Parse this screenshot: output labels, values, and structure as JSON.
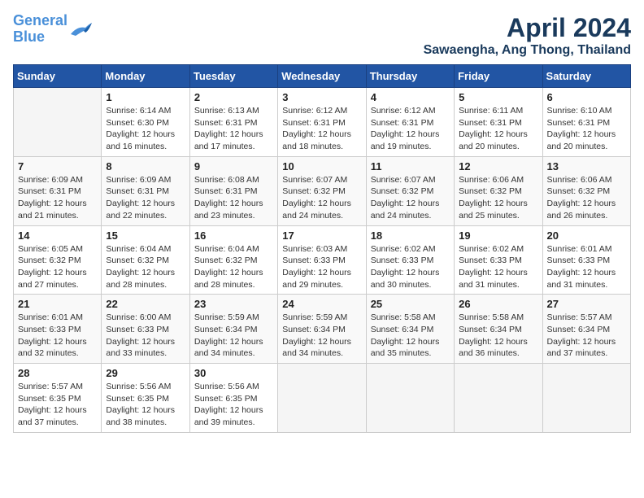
{
  "header": {
    "logo_line1": "General",
    "logo_line2": "Blue",
    "title": "April 2024",
    "subtitle": "Sawaengha, Ang Thong, Thailand"
  },
  "days_of_week": [
    "Sunday",
    "Monday",
    "Tuesday",
    "Wednesday",
    "Thursday",
    "Friday",
    "Saturday"
  ],
  "weeks": [
    [
      {
        "day": "",
        "sunrise": "",
        "sunset": "",
        "daylight": ""
      },
      {
        "day": "1",
        "sunrise": "Sunrise: 6:14 AM",
        "sunset": "Sunset: 6:30 PM",
        "daylight": "Daylight: 12 hours and 16 minutes."
      },
      {
        "day": "2",
        "sunrise": "Sunrise: 6:13 AM",
        "sunset": "Sunset: 6:31 PM",
        "daylight": "Daylight: 12 hours and 17 minutes."
      },
      {
        "day": "3",
        "sunrise": "Sunrise: 6:12 AM",
        "sunset": "Sunset: 6:31 PM",
        "daylight": "Daylight: 12 hours and 18 minutes."
      },
      {
        "day": "4",
        "sunrise": "Sunrise: 6:12 AM",
        "sunset": "Sunset: 6:31 PM",
        "daylight": "Daylight: 12 hours and 19 minutes."
      },
      {
        "day": "5",
        "sunrise": "Sunrise: 6:11 AM",
        "sunset": "Sunset: 6:31 PM",
        "daylight": "Daylight: 12 hours and 20 minutes."
      },
      {
        "day": "6",
        "sunrise": "Sunrise: 6:10 AM",
        "sunset": "Sunset: 6:31 PM",
        "daylight": "Daylight: 12 hours and 20 minutes."
      }
    ],
    [
      {
        "day": "7",
        "sunrise": "Sunrise: 6:09 AM",
        "sunset": "Sunset: 6:31 PM",
        "daylight": "Daylight: 12 hours and 21 minutes."
      },
      {
        "day": "8",
        "sunrise": "Sunrise: 6:09 AM",
        "sunset": "Sunset: 6:31 PM",
        "daylight": "Daylight: 12 hours and 22 minutes."
      },
      {
        "day": "9",
        "sunrise": "Sunrise: 6:08 AM",
        "sunset": "Sunset: 6:31 PM",
        "daylight": "Daylight: 12 hours and 23 minutes."
      },
      {
        "day": "10",
        "sunrise": "Sunrise: 6:07 AM",
        "sunset": "Sunset: 6:32 PM",
        "daylight": "Daylight: 12 hours and 24 minutes."
      },
      {
        "day": "11",
        "sunrise": "Sunrise: 6:07 AM",
        "sunset": "Sunset: 6:32 PM",
        "daylight": "Daylight: 12 hours and 24 minutes."
      },
      {
        "day": "12",
        "sunrise": "Sunrise: 6:06 AM",
        "sunset": "Sunset: 6:32 PM",
        "daylight": "Daylight: 12 hours and 25 minutes."
      },
      {
        "day": "13",
        "sunrise": "Sunrise: 6:06 AM",
        "sunset": "Sunset: 6:32 PM",
        "daylight": "Daylight: 12 hours and 26 minutes."
      }
    ],
    [
      {
        "day": "14",
        "sunrise": "Sunrise: 6:05 AM",
        "sunset": "Sunset: 6:32 PM",
        "daylight": "Daylight: 12 hours and 27 minutes."
      },
      {
        "day": "15",
        "sunrise": "Sunrise: 6:04 AM",
        "sunset": "Sunset: 6:32 PM",
        "daylight": "Daylight: 12 hours and 28 minutes."
      },
      {
        "day": "16",
        "sunrise": "Sunrise: 6:04 AM",
        "sunset": "Sunset: 6:32 PM",
        "daylight": "Daylight: 12 hours and 28 minutes."
      },
      {
        "day": "17",
        "sunrise": "Sunrise: 6:03 AM",
        "sunset": "Sunset: 6:33 PM",
        "daylight": "Daylight: 12 hours and 29 minutes."
      },
      {
        "day": "18",
        "sunrise": "Sunrise: 6:02 AM",
        "sunset": "Sunset: 6:33 PM",
        "daylight": "Daylight: 12 hours and 30 minutes."
      },
      {
        "day": "19",
        "sunrise": "Sunrise: 6:02 AM",
        "sunset": "Sunset: 6:33 PM",
        "daylight": "Daylight: 12 hours and 31 minutes."
      },
      {
        "day": "20",
        "sunrise": "Sunrise: 6:01 AM",
        "sunset": "Sunset: 6:33 PM",
        "daylight": "Daylight: 12 hours and 31 minutes."
      }
    ],
    [
      {
        "day": "21",
        "sunrise": "Sunrise: 6:01 AM",
        "sunset": "Sunset: 6:33 PM",
        "daylight": "Daylight: 12 hours and 32 minutes."
      },
      {
        "day": "22",
        "sunrise": "Sunrise: 6:00 AM",
        "sunset": "Sunset: 6:33 PM",
        "daylight": "Daylight: 12 hours and 33 minutes."
      },
      {
        "day": "23",
        "sunrise": "Sunrise: 5:59 AM",
        "sunset": "Sunset: 6:34 PM",
        "daylight": "Daylight: 12 hours and 34 minutes."
      },
      {
        "day": "24",
        "sunrise": "Sunrise: 5:59 AM",
        "sunset": "Sunset: 6:34 PM",
        "daylight": "Daylight: 12 hours and 34 minutes."
      },
      {
        "day": "25",
        "sunrise": "Sunrise: 5:58 AM",
        "sunset": "Sunset: 6:34 PM",
        "daylight": "Daylight: 12 hours and 35 minutes."
      },
      {
        "day": "26",
        "sunrise": "Sunrise: 5:58 AM",
        "sunset": "Sunset: 6:34 PM",
        "daylight": "Daylight: 12 hours and 36 minutes."
      },
      {
        "day": "27",
        "sunrise": "Sunrise: 5:57 AM",
        "sunset": "Sunset: 6:34 PM",
        "daylight": "Daylight: 12 hours and 37 minutes."
      }
    ],
    [
      {
        "day": "28",
        "sunrise": "Sunrise: 5:57 AM",
        "sunset": "Sunset: 6:35 PM",
        "daylight": "Daylight: 12 hours and 37 minutes."
      },
      {
        "day": "29",
        "sunrise": "Sunrise: 5:56 AM",
        "sunset": "Sunset: 6:35 PM",
        "daylight": "Daylight: 12 hours and 38 minutes."
      },
      {
        "day": "30",
        "sunrise": "Sunrise: 5:56 AM",
        "sunset": "Sunset: 6:35 PM",
        "daylight": "Daylight: 12 hours and 39 minutes."
      },
      {
        "day": "",
        "sunrise": "",
        "sunset": "",
        "daylight": ""
      },
      {
        "day": "",
        "sunrise": "",
        "sunset": "",
        "daylight": ""
      },
      {
        "day": "",
        "sunrise": "",
        "sunset": "",
        "daylight": ""
      },
      {
        "day": "",
        "sunrise": "",
        "sunset": "",
        "daylight": ""
      }
    ]
  ]
}
